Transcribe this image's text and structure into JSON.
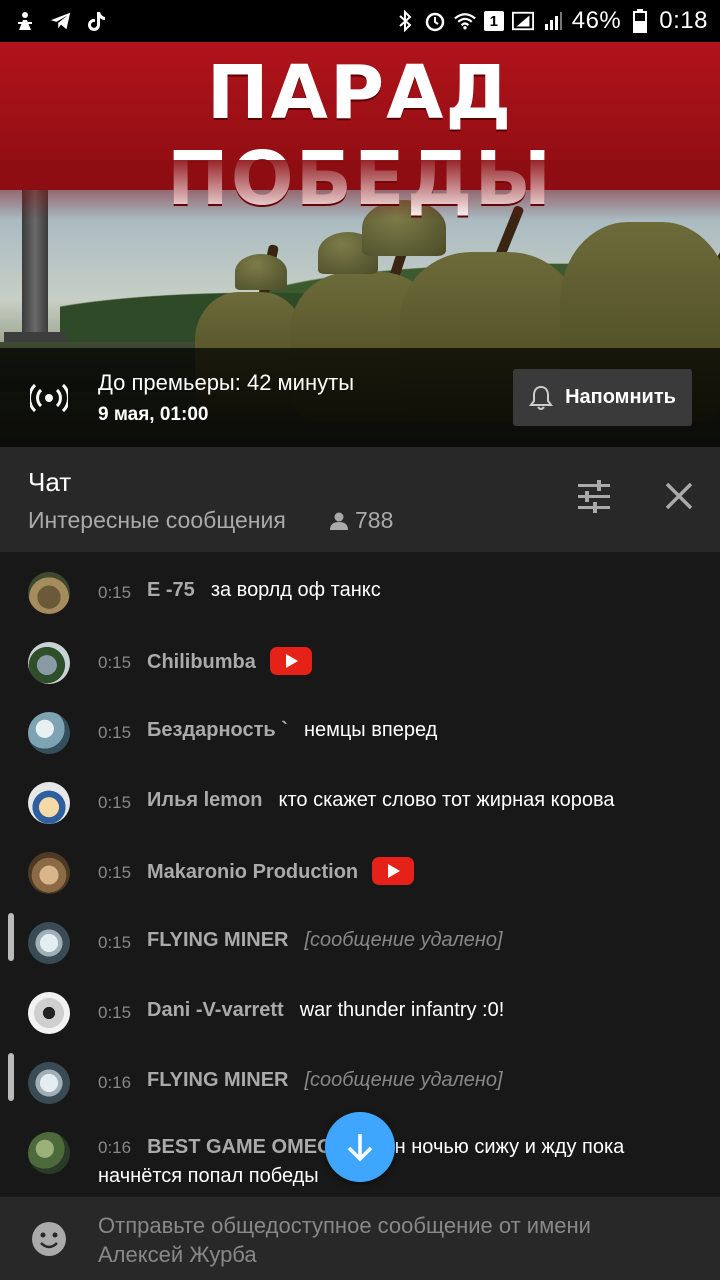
{
  "status_bar": {
    "battery": "46%",
    "time": "0:18",
    "sim_badge": "1",
    "icons": [
      "person-walking-icon",
      "telegram-icon",
      "tiktok-icon",
      "bluetooth-icon",
      "alarm-icon",
      "wifi-icon",
      "signal-icon",
      "battery-icon"
    ]
  },
  "video": {
    "banner_title": "ПАРАД ПОБЕДЫ",
    "premiere_title": "До премьеры: 42 минуты",
    "premiere_date": "9 мая, 01:00",
    "remind_label": "Напомнить"
  },
  "chat": {
    "title": "Чат",
    "mode": "Интересные сообщения",
    "viewers": "788"
  },
  "messages": [
    {
      "time": "0:15",
      "author": "E -75",
      "text": "за ворлд оф танкс",
      "badge": false,
      "deleted": false
    },
    {
      "time": "0:15",
      "author": "Chilibumba",
      "text": "",
      "badge": true,
      "deleted": false
    },
    {
      "time": "0:15",
      "author": "Бездарность `",
      "text": "немцы вперед",
      "badge": false,
      "deleted": false
    },
    {
      "time": "0:15",
      "author": "Илья lemon",
      "text": "кто скажет слово тот жирная корова",
      "badge": false,
      "deleted": false
    },
    {
      "time": "0:15",
      "author": "Makaronio Production",
      "text": "",
      "badge": true,
      "deleted": false
    },
    {
      "time": "0:15",
      "author": "FLYING MINER",
      "text": "[сообщение удалено]",
      "badge": false,
      "deleted": true
    },
    {
      "time": "0:15",
      "author": "Dani -V-varrett",
      "text": "war thunder infantry :0!",
      "badge": false,
      "deleted": false
    },
    {
      "time": "0:16",
      "author": "FLYING MINER",
      "text": "[сообщение удалено]",
      "badge": false,
      "deleted": true
    },
    {
      "time": "0:16",
      "author": "BEST GAME OMEGA",
      "text": "один ночью сижу и жду пока начнётся попал победы",
      "badge": false,
      "deleted": false
    }
  ],
  "input": {
    "placeholder": "Отправьте общедоступное сообщение от имени Алексей Журба"
  },
  "colors": {
    "accent_blue": "#3ea6ff",
    "youtube_red": "#e62117",
    "header_bg": "#282828",
    "chat_bg": "#181818"
  }
}
